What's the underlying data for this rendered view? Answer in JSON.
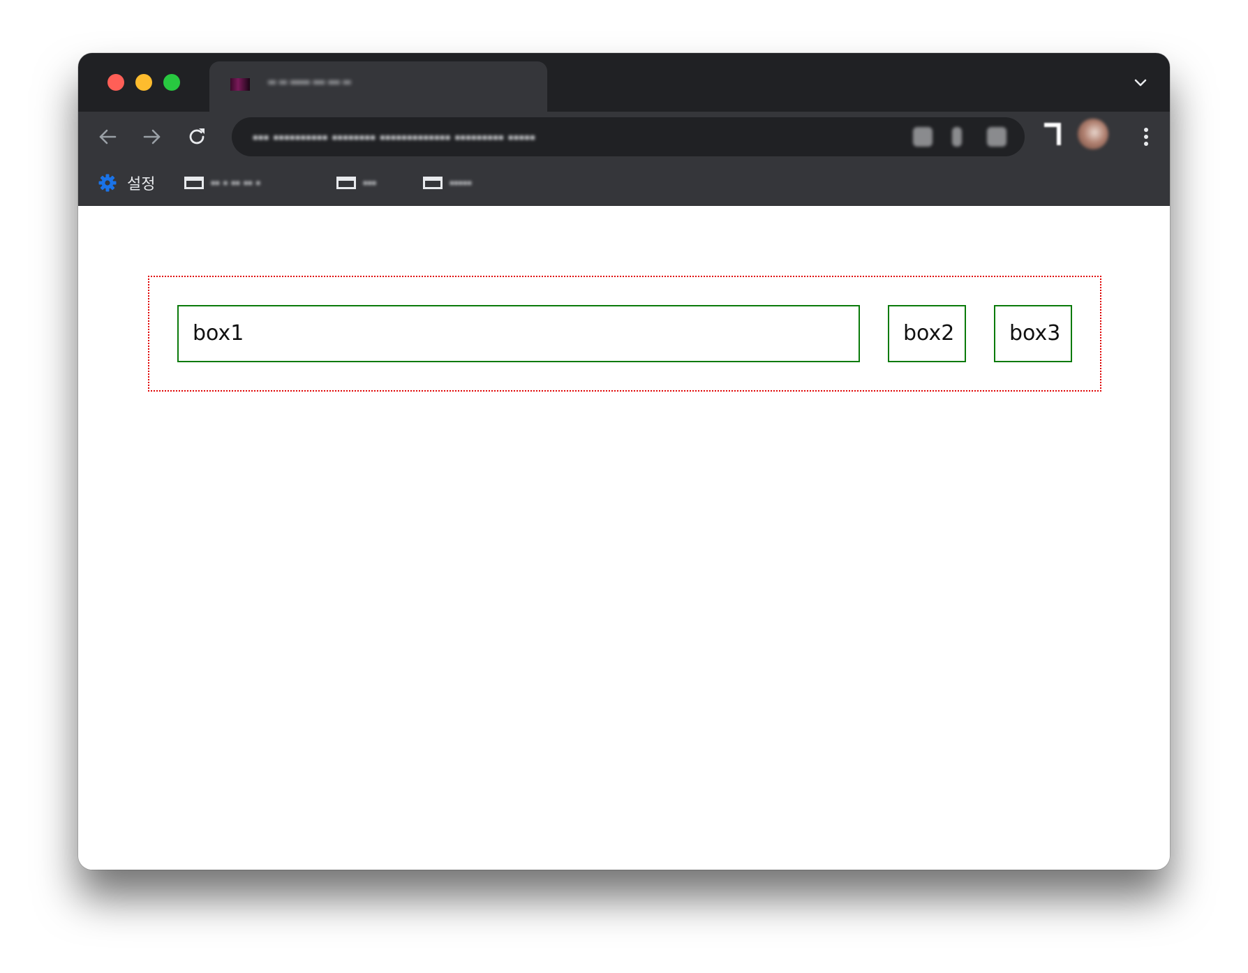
{
  "browser": {
    "tab": {
      "title": "▪▪ ▪▪ ▪▪▪▪▪ ▪▪▪ ▪▪▪ ▪▪",
      "favicon": "site-favicon"
    },
    "address_bar": {
      "url": "▪▪▪ ▪▪▪▪▪▪▪▪▪▪ ▪▪▪▪▪▪▪▪ ▪▪▪▪▪▪▪▪▪▪▪▪▪ ▪▪▪▪▪▪▪▪▪ ▪▪▪▪▪"
    },
    "icons": {
      "back": "arrow-left-icon",
      "forward": "arrow-right-icon",
      "reload": "reload-icon",
      "tab_dropdown": "chevron-down-icon",
      "menu": "kebab-menu-icon"
    },
    "bookmarks": [
      {
        "label": "설정",
        "icon": "gear-icon"
      },
      {
        "label": "▪▪ ▪ ▪▪ ▪▪ ▪",
        "icon": "folder-icon"
      },
      {
        "label": "▪▪▪",
        "icon": "folder-icon"
      },
      {
        "label": "▪▪▪▪▪",
        "icon": "folder-icon"
      }
    ]
  },
  "page": {
    "boxes": [
      {
        "label": "box1"
      },
      {
        "label": "box2"
      },
      {
        "label": "box3"
      }
    ]
  },
  "colors": {
    "container_border": "#e00000",
    "box_border": "#0a7a0a",
    "settings_gear": "#1a73e8"
  }
}
